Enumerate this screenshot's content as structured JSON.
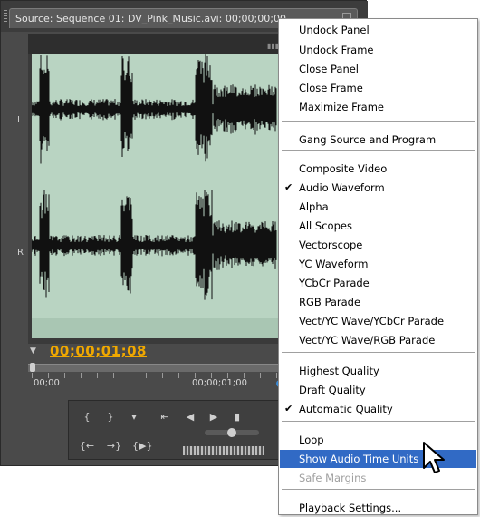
{
  "panel": {
    "tab_title": "Source: Sequence 01: DV_Pink_Music.avi: 00;00;00;00",
    "channel_left": "L",
    "channel_right": "R",
    "timecode": "00;00;01;08",
    "timeline_start": "00;00",
    "timeline_mid": "00;00;01;00"
  },
  "menu": {
    "items": [
      {
        "label": "Undock Panel"
      },
      {
        "label": "Undock Frame"
      },
      {
        "label": "Close Panel"
      },
      {
        "label": "Close Frame"
      },
      {
        "label": "Maximize Frame"
      },
      {
        "label": "Gang Source and Program"
      },
      {
        "label": "Composite Video"
      },
      {
        "label": "Audio Waveform",
        "checked": true
      },
      {
        "label": "Alpha"
      },
      {
        "label": "All Scopes"
      },
      {
        "label": "Vectorscope"
      },
      {
        "label": "YC Waveform"
      },
      {
        "label": "YCbCr Parade"
      },
      {
        "label": "RGB Parade"
      },
      {
        "label": "Vect/YC Wave/YCbCr Parade"
      },
      {
        "label": "Vect/YC Wave/RGB Parade"
      },
      {
        "label": "Highest Quality"
      },
      {
        "label": "Draft Quality"
      },
      {
        "label": "Automatic Quality",
        "checked": true
      },
      {
        "label": "Loop"
      },
      {
        "label": "Show Audio Time Units",
        "highlighted": true
      },
      {
        "label": "Safe Margins",
        "disabled": true
      },
      {
        "label": "Playback Settings..."
      }
    ],
    "checkmark": "✔"
  },
  "colors": {
    "accent_timecode": "#f0a800",
    "highlight": "#316ac5",
    "waveform_bg": "#b9d4c2"
  }
}
